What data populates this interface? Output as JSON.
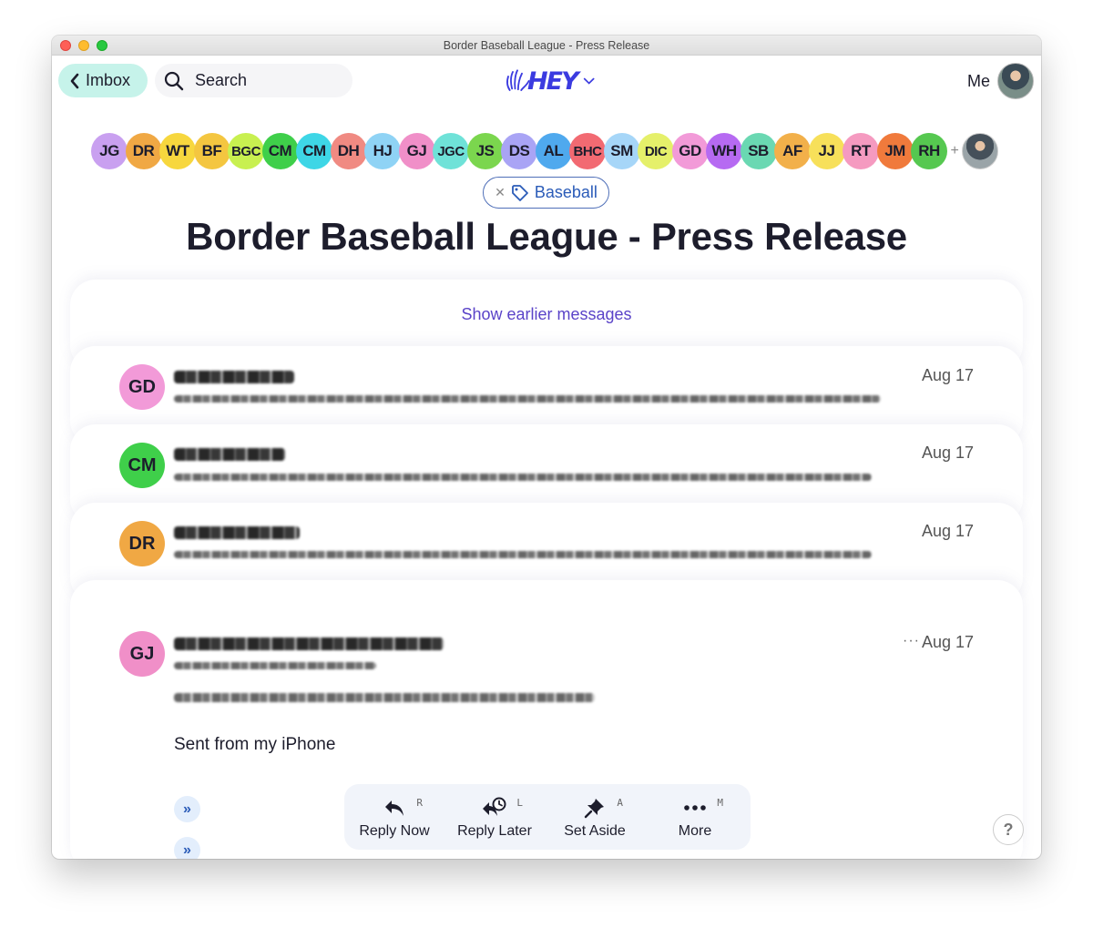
{
  "window": {
    "title": "Border Baseball League - Press Release"
  },
  "topbar": {
    "back_label": "Imbox",
    "search_label": "Search",
    "logo_text": "HEY",
    "me_label": "Me"
  },
  "participants": [
    {
      "initials": "JG",
      "color": "#c9a0f0"
    },
    {
      "initials": "DR",
      "color": "#f0a844"
    },
    {
      "initials": "WT",
      "color": "#f7d73e"
    },
    {
      "initials": "BF",
      "color": "#f4c640"
    },
    {
      "initials": "BGC",
      "color": "#c8f050"
    },
    {
      "initials": "CM",
      "color": "#3fcf4a"
    },
    {
      "initials": "CM",
      "color": "#3ed6e6"
    },
    {
      "initials": "DH",
      "color": "#f08a82"
    },
    {
      "initials": "HJ",
      "color": "#8fd3f5"
    },
    {
      "initials": "GJ",
      "color": "#f08fc8"
    },
    {
      "initials": "JGC",
      "color": "#6fe2d8"
    },
    {
      "initials": "JS",
      "color": "#7bd64e"
    },
    {
      "initials": "DS",
      "color": "#a9a4f5"
    },
    {
      "initials": "AL",
      "color": "#4fa9ee"
    },
    {
      "initials": "BHC",
      "color": "#f26a72"
    },
    {
      "initials": "SM",
      "color": "#a6d6f8"
    },
    {
      "initials": "DIC",
      "color": "#e5f06a"
    },
    {
      "initials": "GD",
      "color": "#f29ad8"
    },
    {
      "initials": "WH",
      "color": "#b66af2"
    },
    {
      "initials": "SB",
      "color": "#6ad8b2"
    },
    {
      "initials": "AF",
      "color": "#f2b04a"
    },
    {
      "initials": "JJ",
      "color": "#f7e05a"
    },
    {
      "initials": "RT",
      "color": "#f59ac0"
    },
    {
      "initials": "JM",
      "color": "#f07a3c"
    },
    {
      "initials": "RH",
      "color": "#56c850"
    }
  ],
  "participants_more": "+",
  "tag": {
    "label": "Baseball"
  },
  "subject": "Border Baseball League - Press Release",
  "thread": {
    "show_earlier": "Show earlier messages",
    "messages": [
      {
        "initials": "GD",
        "color": "#f29ad8",
        "date": "Aug 17"
      },
      {
        "initials": "CM",
        "color": "#3fcf4a",
        "date": "Aug 17"
      },
      {
        "initials": "DR",
        "color": "#f0a844",
        "date": "Aug 17"
      }
    ],
    "open_message": {
      "initials": "GJ",
      "color": "#f08fc8",
      "date": "Aug 17",
      "more_dots": "···",
      "signature": "Sent from my iPhone"
    }
  },
  "actions": [
    {
      "label": "Reply Now",
      "shortcut": "R",
      "icon": "reply-icon"
    },
    {
      "label": "Reply Later",
      "shortcut": "L",
      "icon": "reply-later-icon"
    },
    {
      "label": "Set Aside",
      "shortcut": "A",
      "icon": "pin-icon"
    },
    {
      "label": "More",
      "shortcut": "M",
      "icon": "more-icon"
    }
  ],
  "help": "?"
}
